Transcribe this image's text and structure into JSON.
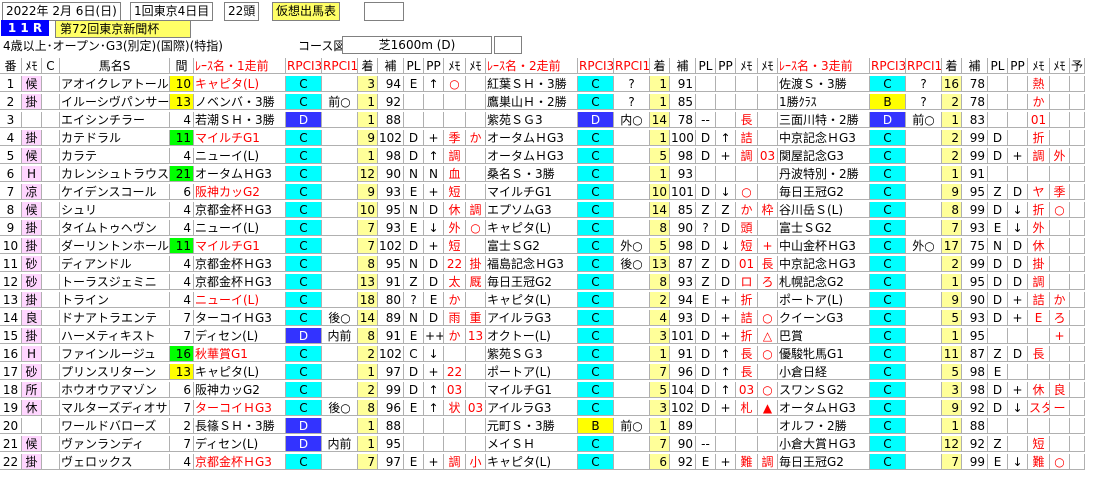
{
  "header": {
    "date": "2022年 2月 6日(日)",
    "meeting": "1回東京4日目",
    "runners": "22頭",
    "mode": "仮想出馬表",
    "race_no": "1 1 R",
    "race_name": "第72回東京新聞杯",
    "conditions": "4歳以上･オープン･G3(別定)(国際)(特指)",
    "course_label": "コース図",
    "course": "芝1600m (D)"
  },
  "columns": [
    "番",
    "ﾒﾓ",
    "C",
    "馬名S",
    "間",
    "ﾚｰｽ名・1走前",
    "RPCI3",
    "RPCI1",
    "着",
    "補",
    "PL",
    "PP",
    "ﾒﾓ",
    "ﾒﾓ",
    "ﾚｰｽ名・2走前",
    "RPCI3",
    "RPCI1",
    "着",
    "補",
    "PL",
    "PP",
    "ﾒﾓ",
    "ﾒﾓ",
    "ﾚｰｽ名・3走前",
    "RPCI3",
    "RPCI1",
    "着",
    "補",
    "PL",
    "PP",
    "ﾒﾓ",
    "ﾒﾓ",
    "予"
  ],
  "colors": {
    "pink": "#ffd6ff",
    "cyan": "#00ffff",
    "blue": "#3333ff",
    "yellow": "#ffff00",
    "green": "#00ff00",
    "red": "#ff0000"
  },
  "rows": [
    {
      "no": "1",
      "mark": "候",
      "c": "",
      "name": "アオイクレアトール",
      "gap": "10",
      "gapc": "yellow",
      "r1": [
        "キャピタ(L)",
        "C",
        "",
        "3",
        "94",
        "E",
        "↑",
        "○",
        ""
      ],
      "r2": [
        "紅葉ＳＨ・3勝",
        "C",
        "?",
        "1",
        "91",
        "",
        "",
        "",
        ""
      ],
      "r3": [
        "佐渡Ｓ・3勝",
        "C",
        "?",
        "16",
        "78",
        "",
        "",
        "熱",
        ""
      ]
    },
    {
      "no": "2",
      "mark": "掛",
      "c": "",
      "name": "イルーシヴパンサー",
      "gap": "13",
      "gapc": "yellow",
      "r1": [
        "ノベンバ・3勝",
        "C",
        "前○",
        "1",
        "92",
        "",
        "",
        "",
        ""
      ],
      "r2": [
        "鷹巣山Ｈ・2勝",
        "C",
        "?",
        "1",
        "85",
        "",
        "",
        "",
        ""
      ],
      "r3": [
        "1勝ｸﾗｽ",
        "B",
        "?",
        "2",
        "78",
        "",
        "",
        "か",
        ""
      ]
    },
    {
      "no": "3",
      "mark": "",
      "c": "",
      "name": "エイシンチラー",
      "gap": "4",
      "gapc": "",
      "r1": [
        "若潮ＳＨ・3勝",
        "D",
        "",
        "1",
        "88",
        "",
        "",
        "",
        ""
      ],
      "r2": [
        "紫苑ＳＧ3",
        "D",
        "内○",
        "14",
        "78",
        "--",
        "",
        "長",
        ""
      ],
      "r3": [
        "三面川特・2勝",
        "D",
        "前○",
        "1",
        "83",
        "",
        "",
        "01",
        ""
      ]
    },
    {
      "no": "4",
      "mark": "掛",
      "c": "",
      "name": "カテドラル",
      "gap": "11",
      "gapc": "green",
      "r1": [
        "マイルチG1",
        "C",
        "",
        "9",
        "102",
        "D",
        "+",
        "季",
        "か"
      ],
      "r2": [
        "オータムＨG3",
        "C",
        "",
        "1",
        "100",
        "D",
        "↑",
        "詰",
        ""
      ],
      "r3": [
        "中京記念ＨG3",
        "C",
        "",
        "2",
        "99",
        "D",
        "",
        "折",
        ""
      ]
    },
    {
      "no": "5",
      "mark": "候",
      "c": "",
      "name": "カラテ",
      "gap": "4",
      "gapc": "",
      "r1": [
        "ニューイ(L)",
        "C",
        "",
        "1",
        "98",
        "D",
        "↑",
        "調",
        ""
      ],
      "r2": [
        "オータムＨG3",
        "C",
        "",
        "5",
        "98",
        "D",
        "+",
        "調",
        "03"
      ],
      "r3": [
        "関屋記念G3",
        "C",
        "",
        "2",
        "99",
        "D",
        "+",
        "調",
        "外"
      ]
    },
    {
      "no": "6",
      "mark": "H",
      "c": "",
      "name": "カレンシュトラウス",
      "gap": "21",
      "gapc": "green",
      "r1": [
        "オータムＨG3",
        "C",
        "",
        "12",
        "90",
        "N",
        "N",
        "血",
        ""
      ],
      "r2": [
        "桑名Ｓ・3勝",
        "C",
        "",
        "1",
        "93",
        "",
        "",
        "",
        ""
      ],
      "r3": [
        "丹波特別・2勝",
        "C",
        "",
        "1",
        "91",
        "",
        "",
        "",
        ""
      ]
    },
    {
      "no": "7",
      "mark": "凉",
      "c": "",
      "name": "ケイデンスコール",
      "gap": "6",
      "gapc": "",
      "r1": [
        "阪神カッG2",
        "C",
        "",
        "9",
        "93",
        "E",
        "+",
        "短",
        ""
      ],
      "r2": [
        "マイルチG1",
        "C",
        "",
        "10",
        "101",
        "D",
        "↓",
        "○",
        ""
      ],
      "r3": [
        "毎日王冠G2",
        "C",
        "",
        "9",
        "95",
        "Z",
        "D",
        "ヤ",
        "季"
      ]
    },
    {
      "no": "8",
      "mark": "候",
      "c": "",
      "name": "シュリ",
      "gap": "4",
      "gapc": "",
      "r1": [
        "京都金杯ＨG3",
        "C",
        "",
        "10",
        "95",
        "N",
        "D",
        "休",
        "調"
      ],
      "r2": [
        "エプソムG3",
        "C",
        "",
        "14",
        "85",
        "Z",
        "Z",
        "か",
        "枠"
      ],
      "r3": [
        "谷川岳Ｓ(L)",
        "C",
        "",
        "8",
        "99",
        "D",
        "↓",
        "折",
        "○"
      ]
    },
    {
      "no": "9",
      "mark": "掛",
      "c": "",
      "name": "タイムトゥヘヴン",
      "gap": "4",
      "gapc": "",
      "r1": [
        "ニューイ(L)",
        "C",
        "",
        "7",
        "93",
        "E",
        "↓",
        "外",
        "○"
      ],
      "r2": [
        "キャピタ(L)",
        "C",
        "",
        "8",
        "90",
        "?",
        "D",
        "頭",
        ""
      ],
      "r3": [
        "富士ＳG2",
        "C",
        "",
        "7",
        "93",
        "E",
        "↓",
        "外",
        ""
      ]
    },
    {
      "no": "10",
      "mark": "掛",
      "c": "",
      "name": "ダーリントンホール",
      "gap": "11",
      "gapc": "green",
      "r1": [
        "マイルチG1",
        "C",
        "",
        "7",
        "102",
        "D",
        "+",
        "短",
        ""
      ],
      "r2": [
        "富士ＳG2",
        "C",
        "外○",
        "5",
        "98",
        "D",
        "↓",
        "短",
        "+"
      ],
      "r3": [
        "中山金杯ＨG3",
        "C",
        "外○",
        "17",
        "75",
        "N",
        "D",
        "休",
        ""
      ]
    },
    {
      "no": "11",
      "mark": "砂",
      "c": "",
      "name": "ディアンドル",
      "gap": "4",
      "gapc": "",
      "r1": [
        "京都金杯ＨG3",
        "C",
        "",
        "8",
        "95",
        "N",
        "D",
        "22",
        "掛"
      ],
      "r2": [
        "福島記念ＨG3",
        "C",
        "後○",
        "13",
        "87",
        "Z",
        "D",
        "01",
        "長"
      ],
      "r3": [
        "中京記念ＨG3",
        "C",
        "",
        "2",
        "99",
        "D",
        "D",
        "掛",
        ""
      ]
    },
    {
      "no": "12",
      "mark": "砂",
      "c": "",
      "name": "トーラスジェミニ",
      "gap": "4",
      "gapc": "",
      "r1": [
        "京都金杯ＨG3",
        "C",
        "",
        "13",
        "91",
        "Z",
        "D",
        "太",
        "厩"
      ],
      "r2": [
        "毎日王冠G2",
        "C",
        "",
        "8",
        "93",
        "Z",
        "D",
        "ロ",
        "ろ"
      ],
      "r3": [
        "札幌記念G2",
        "C",
        "",
        "1",
        "95",
        "D",
        "D",
        "調",
        ""
      ]
    },
    {
      "no": "13",
      "mark": "掛",
      "c": "",
      "name": "トライン",
      "gap": "4",
      "gapc": "",
      "r1": [
        "ニューイ(L)",
        "C",
        "",
        "18",
        "80",
        "?",
        "E",
        "か",
        ""
      ],
      "r2": [
        "キャピタ(L)",
        "C",
        "",
        "2",
        "94",
        "E",
        "+",
        "折",
        ""
      ],
      "r3": [
        "ポートア(L)",
        "C",
        "",
        "9",
        "90",
        "D",
        "+",
        "詰",
        "か"
      ]
    },
    {
      "no": "14",
      "mark": "良",
      "c": "",
      "name": "ドナアトラエンテ",
      "gap": "7",
      "gapc": "",
      "r1": [
        "ターコイＨG3",
        "C",
        "後○",
        "14",
        "89",
        "N",
        "D",
        "雨",
        "重"
      ],
      "r2": [
        "アイルラG3",
        "C",
        "",
        "4",
        "93",
        "D",
        "+",
        "詰",
        "○"
      ],
      "r3": [
        "クイーンG3",
        "C",
        "",
        "5",
        "93",
        "D",
        "+",
        "E",
        "ろ"
      ]
    },
    {
      "no": "15",
      "mark": "掛",
      "c": "",
      "name": "ハーメティキスト",
      "gap": "7",
      "gapc": "",
      "r1": [
        "ディセン(L)",
        "D",
        "内前",
        "8",
        "91",
        "E",
        "++",
        "か",
        "13"
      ],
      "r2": [
        "オクトー(L)",
        "C",
        "",
        "3",
        "101",
        "D",
        "+",
        "折",
        "△"
      ],
      "r3": [
        "巴賞",
        "C",
        "",
        "1",
        "95",
        "",
        "",
        "",
        "+"
      ]
    },
    {
      "no": "16",
      "mark": "H",
      "c": "",
      "name": "ファインルージュ",
      "gap": "16",
      "gapc": "green",
      "r1": [
        "秋華賞G1",
        "C",
        "",
        "2",
        "102",
        "C",
        "↓",
        "",
        " "
      ],
      "r2": [
        "紫苑ＳＧ3",
        "C",
        "",
        "1",
        "91",
        "D",
        "↑",
        "長",
        "○"
      ],
      "r3": [
        "優駿牝馬G1",
        "C",
        "",
        "11",
        "87",
        "Z",
        "D",
        "長",
        ""
      ]
    },
    {
      "no": "17",
      "mark": "砂",
      "c": "",
      "name": "プリンスリターン",
      "gap": "13",
      "gapc": "yellow",
      "r1": [
        "キャピタ(L)",
        "C",
        "",
        "1",
        "97",
        "D",
        "+",
        "22",
        ""
      ],
      "r2": [
        "ポートア(L)",
        "C",
        "",
        "7",
        "96",
        "D",
        "↑",
        "長",
        ""
      ],
      "r3": [
        "小倉日経",
        "C",
        "",
        "5",
        "98",
        "E",
        "",
        "",
        ""
      ]
    },
    {
      "no": "18",
      "mark": "所",
      "c": "",
      "name": "ホウオウアマゾン",
      "gap": "6",
      "gapc": "",
      "r1": [
        "阪神カッG2",
        "C",
        "",
        "2",
        "99",
        "D",
        "↑",
        "03",
        ""
      ],
      "r2": [
        "マイルチG1",
        "C",
        "",
        "5",
        "104",
        "D",
        "↑",
        "03",
        "○"
      ],
      "r3": [
        "スワンＳG2",
        "C",
        "",
        "3",
        "98",
        "D",
        "+",
        "休",
        "良"
      ]
    },
    {
      "no": "19",
      "mark": "休",
      "c": "",
      "name": "マルターズディオサ",
      "gap": "7",
      "gapc": "",
      "r1": [
        "ターコイＨG3",
        "C",
        "後○",
        "8",
        "96",
        "E",
        "↑",
        "状",
        "03"
      ],
      "r2": [
        "アイルラG3",
        "C",
        "",
        "3",
        "102",
        "D",
        "+",
        "札",
        "▲"
      ],
      "r3": [
        "オータムＨG3",
        "C",
        "",
        "9",
        "92",
        "D",
        "↓",
        "スタ",
        "ー"
      ]
    },
    {
      "no": "20",
      "mark": "",
      "c": "",
      "name": "ワールドバローズ",
      "gap": "2",
      "gapc": "",
      "r1": [
        "長篠ＳＨ・3勝",
        "D",
        "",
        "1",
        "88",
        "",
        "",
        "",
        ""
      ],
      "r2": [
        "元町Ｓ・3勝",
        "B",
        "前○",
        "1",
        "89",
        "",
        "",
        "",
        ""
      ],
      "r3": [
        "オルフ・2勝",
        "C",
        "",
        "1",
        "88",
        "",
        "",
        "",
        ""
      ]
    },
    {
      "no": "21",
      "mark": "候",
      "c": "",
      "name": "ヴァンランディ",
      "gap": "7",
      "gapc": "",
      "r1": [
        "ディセン(L)",
        "D",
        "内前",
        "1",
        "95",
        "",
        "",
        "",
        ""
      ],
      "r2": [
        "メイＳＨ",
        "C",
        "",
        "7",
        "90",
        "--",
        "",
        "",
        ""
      ],
      "r3": [
        "小倉大賞ＨG3",
        "C",
        "",
        "12",
        "92",
        "Z",
        "",
        "短",
        ""
      ]
    },
    {
      "no": "22",
      "mark": "掛",
      "c": "",
      "name": "ヴェロックス",
      "gap": "4",
      "gapc": "",
      "r1": [
        "京都金杯ＨG3",
        "C",
        "",
        "7",
        "97",
        "E",
        "+",
        "調",
        "小"
      ],
      "r2": [
        "キャピタ(L)",
        "C",
        "",
        "6",
        "92",
        "E",
        "+",
        "難",
        "調"
      ],
      "r3": [
        "毎日王冠G2",
        "C",
        "",
        "7",
        "99",
        "E",
        "↓",
        "難",
        "○"
      ]
    }
  ]
}
